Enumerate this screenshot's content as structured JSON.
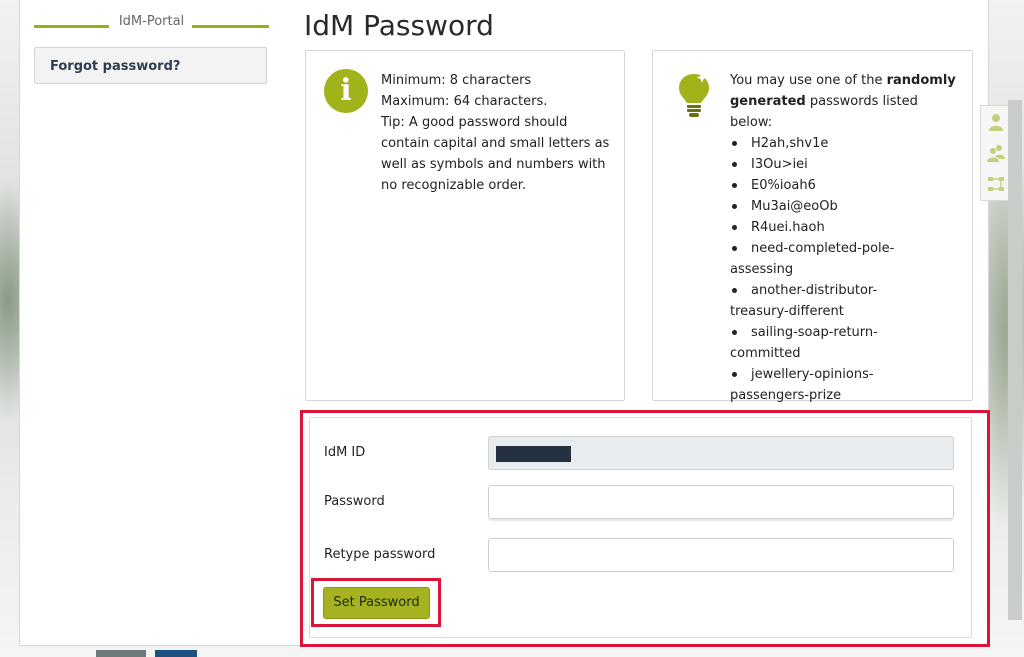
{
  "sidebar": {
    "portal_title": "IdM-Portal",
    "forgot_label": "Forgot password?"
  },
  "page_title": "IdM Password",
  "rules": {
    "min": "Minimum: 8 characters",
    "max": "Maximum: 64 characters.",
    "tip_lines": [
      "Tip: A good password should",
      "contain capital and small letters as",
      "well as symbols and numbers with",
      "no recognizable order."
    ]
  },
  "suggestions": {
    "intro_pre": "You may use one of the ",
    "intro_bold1": "randomly",
    "intro_bold2": "generated",
    "intro_post": " passwords listed below:",
    "items": [
      {
        "l1": "H2ah,shv1e",
        "l2": ""
      },
      {
        "l1": "I3Ou>iei",
        "l2": ""
      },
      {
        "l1": "E0%ioah6",
        "l2": ""
      },
      {
        "l1": "Mu3ai@eoOb",
        "l2": ""
      },
      {
        "l1": "R4uei.haoh",
        "l2": ""
      },
      {
        "l1": "need-completed-pole-",
        "l2": "assessing"
      },
      {
        "l1": "another-distributor-",
        "l2": "treasury-different"
      },
      {
        "l1": "sailing-soap-return-",
        "l2": "committed"
      },
      {
        "l1": "jewellery-opinions-",
        "l2": "passengers-prize"
      }
    ]
  },
  "form": {
    "idm_id_label": "IdM ID",
    "password_label": "Password",
    "retype_label": "Retype password",
    "submit_label": "Set Password"
  },
  "colors": {
    "accent": "#a6b220",
    "highlight": "#d9163a"
  }
}
